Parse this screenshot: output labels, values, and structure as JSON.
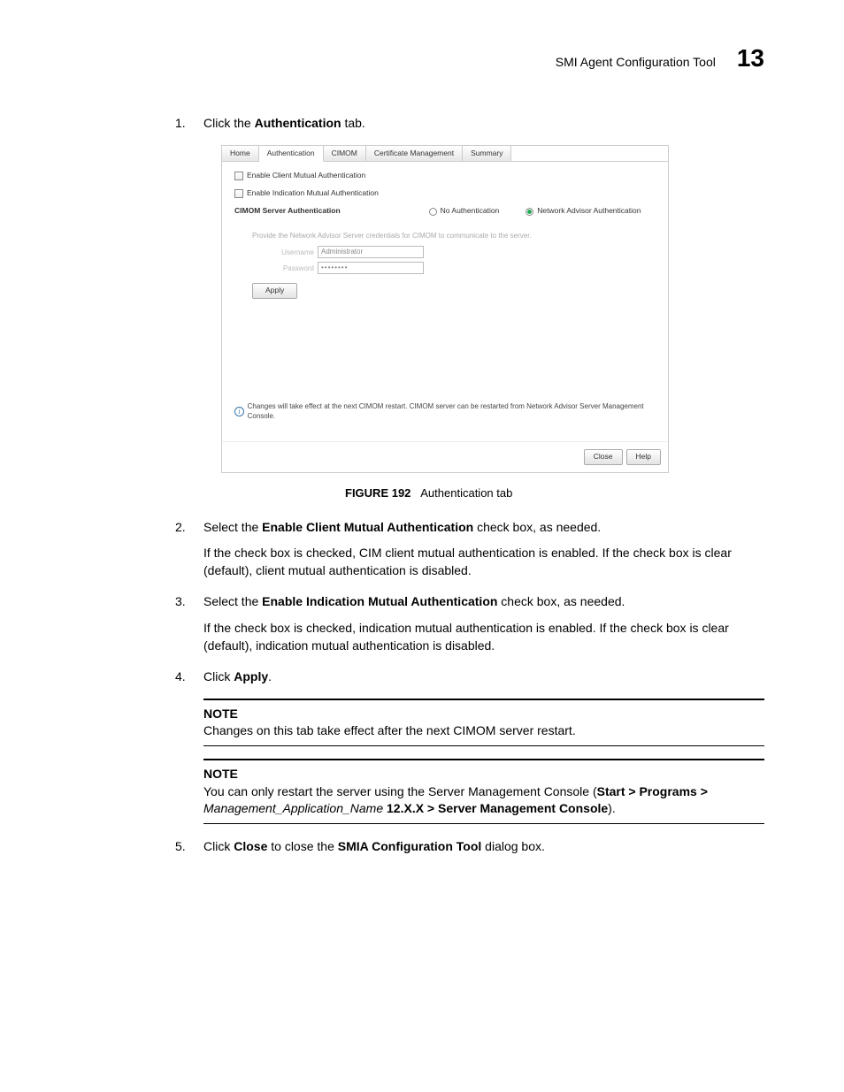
{
  "header": {
    "title": "SMI Agent Configuration Tool",
    "chapter": "13"
  },
  "steps": {
    "s1": {
      "num": "1.",
      "pre": "Click the ",
      "bold": "Authentication",
      "post": " tab."
    },
    "s2": {
      "num": "2.",
      "pre": "Select the ",
      "bold": "Enable Client Mutual Authentication",
      "post": " check box, as needed.",
      "para": "If the check box is checked, CIM client mutual authentication is enabled. If the check box is clear (default), client mutual authentication is disabled."
    },
    "s3": {
      "num": "3.",
      "pre": "Select the ",
      "bold": "Enable Indication Mutual Authentication",
      "post": " check box, as needed.",
      "para": "If the check box is checked, indication mutual authentication is enabled. If the check box is clear (default), indication mutual authentication is disabled."
    },
    "s4": {
      "num": "4.",
      "pre": "Click ",
      "bold": "Apply",
      "post": "."
    },
    "note1": {
      "title": "NOTE",
      "body": "Changes on this tab take effect after the next CIMOM server restart."
    },
    "note2": {
      "title": "NOTE",
      "body_pre": "You can only restart the server using the Server Management Console (",
      "bold1": "Start > Programs > ",
      "italic": "Management_Application_Name",
      "bold2": " 12.X.X > Server Management Console",
      "body_post": ")."
    },
    "s5": {
      "num": "5.",
      "t1": "Click ",
      "b1": "Close",
      "t2": " to close the ",
      "b2": "SMIA Configuration Tool",
      "t3": " dialog box."
    }
  },
  "figure": {
    "label": "FIGURE 192",
    "caption": "Authentication tab"
  },
  "screenshot": {
    "tabs": {
      "t0": "Home",
      "t1": "Authentication",
      "t2": "CIMOM",
      "t3": "Certificate Management",
      "t4": "Summary"
    },
    "chk1": "Enable Client Mutual Authentication",
    "chk2": "Enable Indication Mutual Authentication",
    "radio_label": "CIMOM Server Authentication",
    "radio1": "No Authentication",
    "radio2": "Network Advisor Authentication",
    "hint": "Provide the Network Advisor Server credentials for CIMOM to communicate to the server.",
    "username_label": "Username",
    "username_value": "Administrator",
    "password_label": "Password",
    "password_value": "••••••••",
    "apply": "Apply",
    "info": "Changes will take effect at the next CIMOM restart. CIMOM server can be restarted from Network Advisor Server Management Console.",
    "close": "Close",
    "help": "Help"
  }
}
